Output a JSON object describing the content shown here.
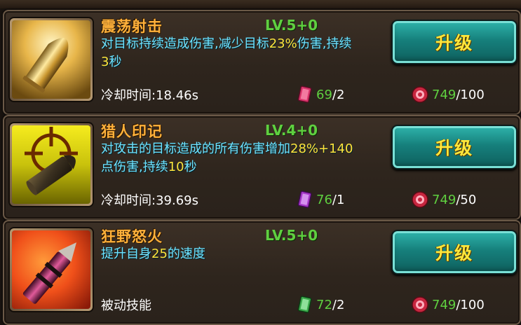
{
  "skills": [
    {
      "name": "震荡射击",
      "level": "LV.5+0",
      "desc_parts": [
        {
          "t": "对目标持续造成伤害,减少目标",
          "hl": false
        },
        {
          "t": "23%",
          "hl": true
        },
        {
          "t": "伤害,持续",
          "hl": false
        },
        {
          "t": "3",
          "hl": true
        },
        {
          "t": "秒",
          "hl": false
        }
      ],
      "cooldown": "冷却时间:18.46s",
      "book_have": "69",
      "book_need": "/2",
      "book_color": "#d8336a",
      "gem_have": "749",
      "gem_need": "/100",
      "upgrade_label": "升级"
    },
    {
      "name": "猎人印记",
      "level": "LV.4+0",
      "desc_parts": [
        {
          "t": "对攻击的目标造成的所有伤害增加",
          "hl": false
        },
        {
          "t": "28%+140",
          "hl": true
        },
        {
          "t": "点伤害,持续",
          "hl": false
        },
        {
          "t": "10",
          "hl": true
        },
        {
          "t": "秒",
          "hl": false
        }
      ],
      "cooldown": "冷却时间:39.69s",
      "book_have": "76",
      "book_need": "/1",
      "book_color": "#a637c9",
      "gem_have": "749",
      "gem_need": "/50",
      "upgrade_label": "升级"
    },
    {
      "name": "狂野怒火",
      "level": "LV.5+0",
      "desc_parts": [
        {
          "t": "提升自身",
          "hl": false
        },
        {
          "t": "25",
          "hl": true
        },
        {
          "t": "的速度",
          "hl": false
        }
      ],
      "cooldown": "被动技能",
      "book_have": "72",
      "book_need": "/2",
      "book_color": "#3aa84a",
      "gem_have": "749",
      "gem_need": "/100",
      "upgrade_label": "升级"
    }
  ],
  "icons": [
    "bullet-icon",
    "crosshair-bullet-icon",
    "firework-rocket-icon",
    "skill-book-icon",
    "gem-icon"
  ]
}
